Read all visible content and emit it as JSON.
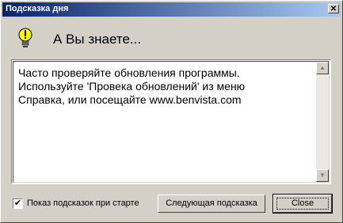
{
  "window": {
    "title": "Подсказка дня",
    "close_glyph": "✕"
  },
  "heading": "А Вы знаете...",
  "tip": {
    "text": "Часто проверяйте обновления программы.\nИспользуйте 'Провека обновлений' из меню\nСправка, или посещайте www.benvista.com"
  },
  "scrollbar": {
    "up_glyph": "▲",
    "down_glyph": "▼"
  },
  "show_on_startup": {
    "label": "Показ подсказок при старте",
    "checked": true,
    "check_glyph": "✔"
  },
  "buttons": {
    "next_label": "Следующая подсказка",
    "close_label": "Close"
  },
  "colors": {
    "titlebar_start": "#0a246a",
    "titlebar_end": "#a6caf0",
    "bulb": "#ffff00"
  }
}
